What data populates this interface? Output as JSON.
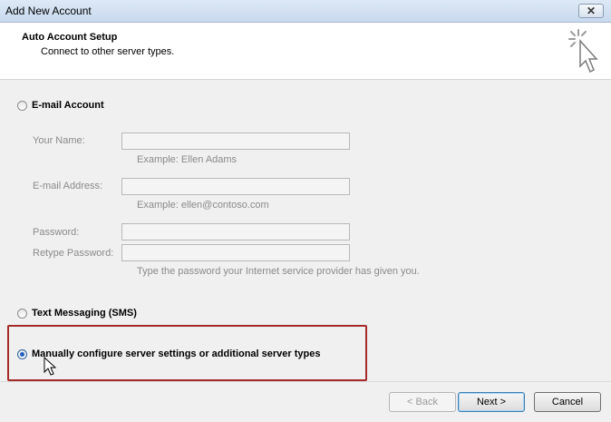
{
  "window": {
    "title": "Add New Account",
    "close_label": "✕"
  },
  "header": {
    "title": "Auto Account Setup",
    "subtitle": "Connect to other server types."
  },
  "options": {
    "email_account": "E-mail Account",
    "text_messaging": "Text Messaging (SMS)",
    "manual": "Manually configure server settings or additional server types"
  },
  "fields": {
    "your_name_label": "Your Name:",
    "your_name_hint": "Example: Ellen Adams",
    "email_label": "E-mail Address:",
    "email_hint": "Example: ellen@contoso.com",
    "password_label": "Password:",
    "retype_label": "Retype Password:",
    "password_hint": "Type the password your Internet service provider has given you."
  },
  "buttons": {
    "back": "< Back",
    "next": "Next >",
    "cancel": "Cancel"
  },
  "icons": {
    "wizard": "magic-wand-cursor-icon",
    "pointer": "mouse-pointer-icon"
  },
  "colors": {
    "highlight": "#a52a2a",
    "selected_radio": "#1f5fbf"
  }
}
